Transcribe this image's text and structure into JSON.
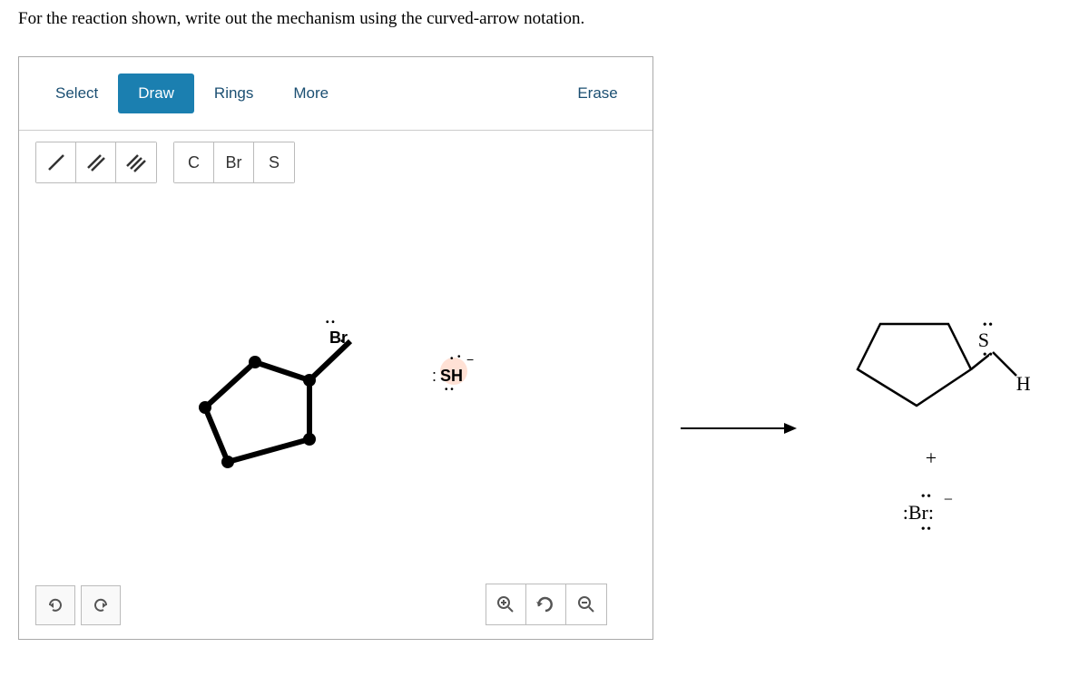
{
  "question": "For the reaction shown, write out the mechanism using the curved-arrow notation.",
  "toolbar": {
    "select": "Select",
    "draw": "Draw",
    "rings": "Rings",
    "more": "More",
    "erase": "Erase"
  },
  "atoms": {
    "c": "C",
    "br": "Br",
    "s": "S"
  },
  "canvas": {
    "br_label": "Br",
    "sh_label": "SH",
    "sh_minus": "−",
    "sh_colon": ":"
  },
  "product": {
    "s": "S",
    "h": "H",
    "plus": "+",
    "br": ":Br:",
    "dots": "• •"
  }
}
